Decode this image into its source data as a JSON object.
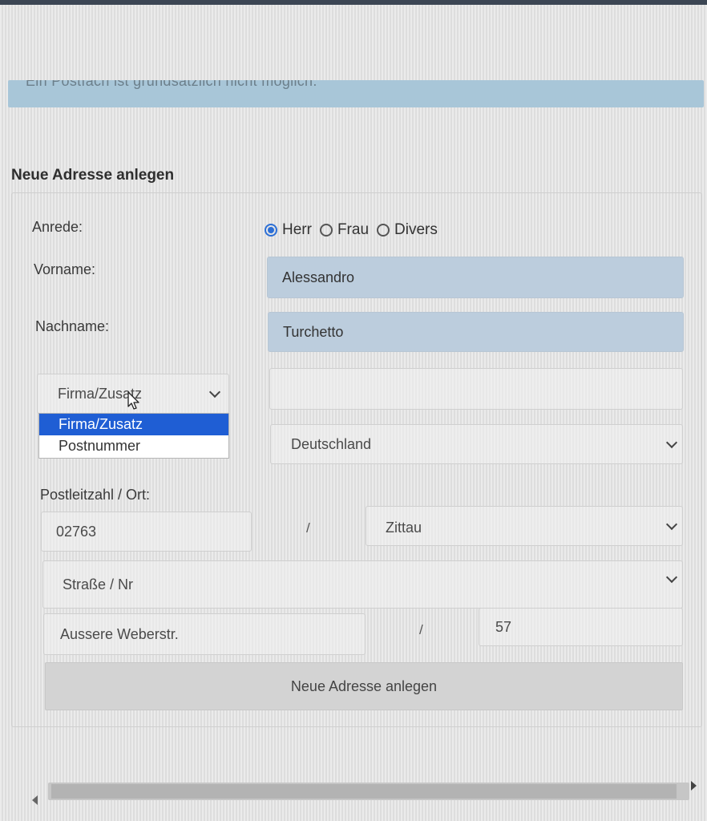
{
  "banner": {
    "text": "Ein Postfach ist grundsätzlich nicht möglich."
  },
  "form": {
    "title": "Neue Adresse anlegen",
    "salutation": {
      "label": "Anrede:",
      "options": [
        {
          "label": "Herr",
          "selected": true
        },
        {
          "label": "Frau",
          "selected": false
        },
        {
          "label": "Divers",
          "selected": false
        }
      ]
    },
    "firstname": {
      "label": "Vorname:",
      "value": "Alessandro"
    },
    "lastname": {
      "label": "Nachname:",
      "value": "Turchetto"
    },
    "extra_select": {
      "value": "Firma/Zusatz",
      "options": [
        "Firma/Zusatz",
        "Postnummer"
      ],
      "highlighted": "Firma/Zusatz"
    },
    "extra_input": {
      "value": ""
    },
    "country": {
      "value": "Deutschland"
    },
    "postal": {
      "label": "Postleitzahl / Ort:",
      "zip": "02763",
      "separator": "/",
      "city": "Zittau"
    },
    "street_select": {
      "value": "Straße / Nr"
    },
    "street": {
      "value": "Aussere Weberstr.",
      "separator": "/",
      "number": "57"
    },
    "submit_label": "Neue Adresse anlegen"
  },
  "colors": {
    "accent": "#1f5ed4",
    "filled_field": "#bccddd",
    "banner": "#a8c6d8"
  }
}
